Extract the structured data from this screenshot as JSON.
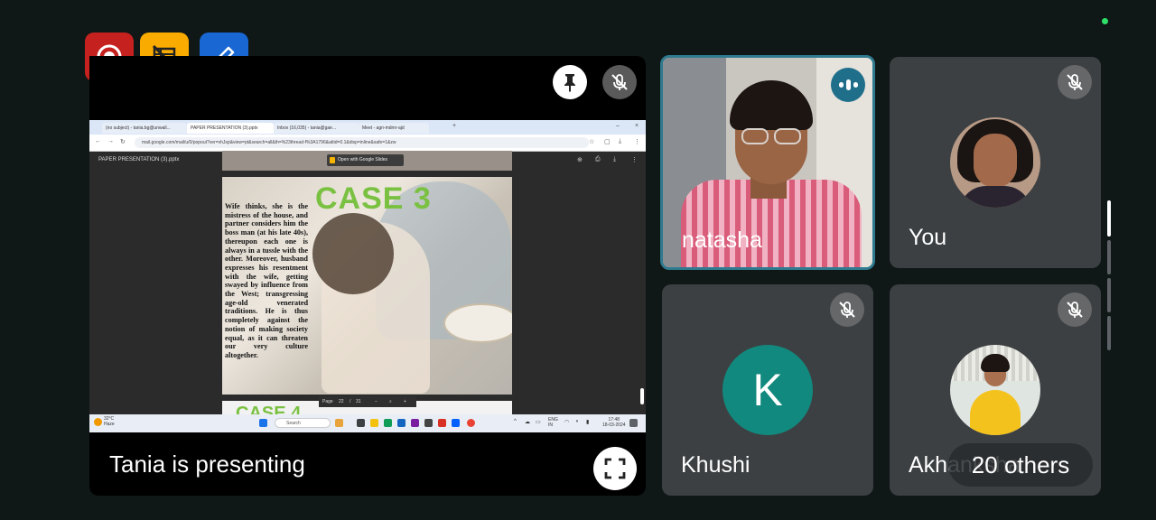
{
  "status_dot_color": "#2ee06a",
  "controls": [
    {
      "name": "stop-recording",
      "icon": "record-icon",
      "color": "#c5221f"
    },
    {
      "name": "captions-off",
      "icon": "no-layout-icon",
      "color": "#f9ab00"
    },
    {
      "name": "annotate",
      "icon": "pen-icon",
      "color": "#1967d2"
    }
  ],
  "presentation": {
    "presenter_label": "Tania is presenting",
    "browser": {
      "tabs": [
        "(no subject) - tania.bg@unwall...",
        "PAPER PRESENTATION (3).pptx",
        "Inbox (16,035) - tania@gae...",
        "Meet - agn-mdmr-ajd"
      ],
      "url": "mail.google.com/mail/u/0/popout?ver=vhJsp&view=pt&search=all&th=%23thread-f%3A1796&attid=0.1&disp=inline&safe=1&zw",
      "viewer_title": "PAPER PRESENTATION (3).pptx",
      "open_with": "Open with Google Slides"
    },
    "slide": {
      "heading": "CASE 3",
      "body": "Wife thinks, she is the mistress of the house, and partner considers him the boss man (at his late 40s), thereupon each one is always in a tussle with the other. Moreover, husband expresses his resentment with the wife, getting swayed by influence from the West; transgressing age-old venerated traditions. He is thus completely against the notion of making society equal, as it can threaten our very culture altogether.",
      "next_heading": "CASE 4"
    },
    "pager": {
      "label": "Page",
      "current": "22",
      "separator": "/",
      "total": "31"
    },
    "taskbar": {
      "weather_temp": "32°C",
      "weather_desc": "Haze",
      "search_placeholder": "Search",
      "lang": "ENG IN",
      "time": "17:48",
      "date": "18-03-2024"
    }
  },
  "participants": [
    {
      "name": "natasha",
      "speaking": true,
      "tile_border": "#2f7a8f"
    },
    {
      "name": "You",
      "muted": true
    },
    {
      "name": "Khushi",
      "initial": "K",
      "avatar_color": "#12897e",
      "muted": true
    },
    {
      "name": "Akhanksha",
      "muted": true
    }
  ],
  "others_label": "20 others"
}
